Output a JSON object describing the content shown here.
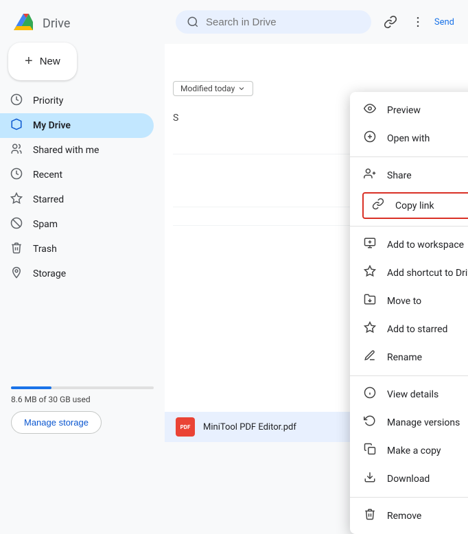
{
  "app": {
    "title": "Drive",
    "logo_alt": "Google Drive"
  },
  "search": {
    "placeholder": "Search in Drive"
  },
  "new_button": {
    "label": "New",
    "plus": "+"
  },
  "sidebar": {
    "items": [
      {
        "id": "priority",
        "label": "Priority",
        "icon": "⏰"
      },
      {
        "id": "my-drive",
        "label": "My Drive",
        "icon": "📁",
        "active": true
      },
      {
        "id": "shared",
        "label": "Shared with me",
        "icon": "👥"
      },
      {
        "id": "recent",
        "label": "Recent",
        "icon": "🕐"
      },
      {
        "id": "starred",
        "label": "Starred",
        "icon": "☆"
      },
      {
        "id": "spam",
        "label": "Spam",
        "icon": "🚫"
      },
      {
        "id": "trash",
        "label": "Trash",
        "icon": "🗑"
      },
      {
        "id": "storage",
        "label": "Storage",
        "icon": "☁"
      }
    ],
    "storage_used": "8.6 MB of 30 GB used",
    "manage_storage_label": "Manage storage"
  },
  "context_menu": {
    "items": [
      {
        "id": "preview",
        "label": "Preview",
        "icon": "👁",
        "has_chevron": false
      },
      {
        "id": "open-with",
        "label": "Open with",
        "icon": "↗",
        "has_chevron": true
      },
      {
        "id": "share",
        "label": "Share",
        "icon": "👤+",
        "has_chevron": false
      },
      {
        "id": "copy-link",
        "label": "Copy link",
        "icon": "🔗",
        "has_chevron": false,
        "highlighted": true
      },
      {
        "id": "add-workspace",
        "label": "Add to workspace",
        "icon": "+",
        "has_chevron": true
      },
      {
        "id": "add-shortcut",
        "label": "Add shortcut to Drive",
        "icon": "⊕",
        "has_chevron": false
      },
      {
        "id": "move-to",
        "label": "Move to",
        "icon": "📂",
        "has_chevron": false
      },
      {
        "id": "add-starred",
        "label": "Add to starred",
        "icon": "☆",
        "has_chevron": false
      },
      {
        "id": "rename",
        "label": "Rename",
        "icon": "✏",
        "has_chevron": false
      },
      {
        "id": "view-details",
        "label": "View details",
        "icon": "ℹ",
        "has_chevron": false
      },
      {
        "id": "manage-versions",
        "label": "Manage versions",
        "icon": "🕐",
        "has_chevron": false
      },
      {
        "id": "make-copy",
        "label": "Make a copy",
        "icon": "📋",
        "has_chevron": false
      },
      {
        "id": "download",
        "label": "Download",
        "icon": "⬇",
        "has_chevron": false
      },
      {
        "id": "remove",
        "label": "Remove",
        "icon": "🗑",
        "has_chevron": false
      }
    ]
  },
  "file_bar": {
    "file_name": "MiniTool PDF Editor.pdf",
    "type_label": "PDF"
  },
  "top_right": {
    "link_icon": "🔗",
    "more_icon": "⋮",
    "send_label": "Send"
  },
  "content": {
    "modified_prefix": "Modified today",
    "section_label": "S"
  }
}
